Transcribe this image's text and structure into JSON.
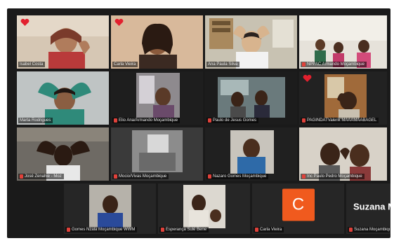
{
  "meeting": {
    "accent_active": "#c7d83a",
    "mic_muted_color": "#e0413a",
    "heart_color": "#e2202e",
    "participants": [
      {
        "name": "Isabel Costa",
        "reaction": "heart"
      },
      {
        "name": "Carla Vieira",
        "reaction": "heart"
      },
      {
        "name": "Ana Paula Silva",
        "active_speaker": true
      },
      {
        "name": "NPPAC Armando Moçambique",
        "muted": true
      },
      {
        "name": "Marta Rodrigues"
      },
      {
        "name": "Elio Ana/Armando Moçambique",
        "muted": true
      },
      {
        "name": "Paulo de Jesus Gomes",
        "muted": true
      },
      {
        "name": "PAGINDATValerik MAAAMAABAGEL",
        "muted": true,
        "reaction": "heart"
      },
      {
        "name": "José Zenahie - Moz",
        "muted": true
      },
      {
        "name": "Mocio/Vivas Moçambique",
        "muted": true
      },
      {
        "name": "Nazaro Gomes Moçambique",
        "muted": true
      },
      {
        "name": "Inc Paulo Pedro Moçambique",
        "muted": true
      },
      {
        "name": "Gomes Nzala Moçambique WWM",
        "muted": true
      },
      {
        "name": "Esperança Sulé Bene",
        "muted": true
      },
      {
        "name": "Carla Vieira",
        "muted": true,
        "avatar_letter": "C",
        "avatar_color": "#f05a1e"
      },
      {
        "name": "Suzana Moçambique",
        "muted": true,
        "display_label": "Suzana M"
      }
    ]
  }
}
